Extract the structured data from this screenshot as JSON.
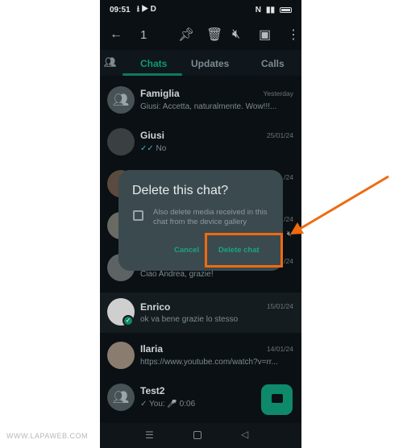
{
  "status": {
    "time": "09:51"
  },
  "topbar": {
    "count": "1"
  },
  "tabs": [
    {
      "label": "Chats",
      "active": true
    },
    {
      "label": "Updates"
    },
    {
      "label": "Calls"
    }
  ],
  "chats": [
    {
      "name": "Famiglia",
      "message": "Giusi: Accetta, naturalmente. Wow!!!...",
      "date": "Yesterday",
      "avatar": "group-icon"
    },
    {
      "name": "Giusi",
      "message": "No",
      "date": "25/01/24",
      "status": "read-double-check"
    },
    {
      "name": "",
      "message": "",
      "date": "/24"
    },
    {
      "name": "",
      "message": "",
      "date": "/24"
    },
    {
      "name": "",
      "message": "Ciao Andrea, grazie!",
      "date": "/24"
    },
    {
      "name": "Enrico",
      "message": "ok va bene grazie lo stesso",
      "date": "15/01/24",
      "selected": true
    },
    {
      "name": "Ilaria",
      "message": "https://www.youtube.com/watch?v=rr...",
      "date": "14/01/24"
    },
    {
      "name": "Test2",
      "message": "You: 🎤 0:06",
      "date": "",
      "status": "sent-check",
      "avatar": "group-icon"
    }
  ],
  "dialog": {
    "title": "Delete this chat?",
    "checkbox_label": "Also delete media received in this chat from the device gallery",
    "checked": false,
    "cancel": "Cancel",
    "confirm": "Delete chat"
  },
  "colors": {
    "accent": "#1aa57e",
    "highlight": "#f06a10"
  },
  "watermark": "WWW.LAPAWEB.COM"
}
